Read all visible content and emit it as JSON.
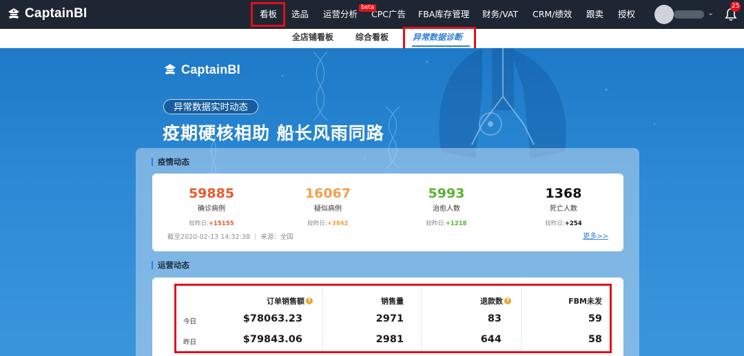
{
  "app": {
    "brand": "CaptainBI"
  },
  "nav": {
    "items": [
      "看板",
      "选品",
      "运营分析",
      "CPC广告",
      "FBA库存管理",
      "财务/VAT",
      "CRM/绩效",
      "跟卖",
      "授权"
    ],
    "beta_badge": "beta",
    "notification_count": "25"
  },
  "subnav": {
    "items": [
      "全店铺看板",
      "综合看板",
      "异常数据诊断"
    ]
  },
  "banner": {
    "brand": "CaptainBI",
    "pill": "异常数据实时动态",
    "headline": "疫期硬核相助 船长风雨同路"
  },
  "epidemic": {
    "title": "疫情动态",
    "stats": [
      {
        "value": "59885",
        "label": "确诊病例",
        "diff_prefix": "较昨日:",
        "diff": "+15155",
        "color": "#e8592c"
      },
      {
        "value": "16067",
        "label": "疑似病例",
        "diff_prefix": "较昨日:",
        "diff": "+3842",
        "color": "#f3a04a"
      },
      {
        "value": "5993",
        "label": "治愈人数",
        "diff_prefix": "较昨日:",
        "diff": "+1218",
        "color": "#58b42f"
      },
      {
        "value": "1368",
        "label": "死亡人数",
        "diff_prefix": "较昨日:",
        "diff": "+254",
        "color": "#111111"
      }
    ],
    "footnote": "截至2020-02-13 14:32:38 ｜ 来源：全国",
    "more_link": "更多>>"
  },
  "operations": {
    "title": "运营动态",
    "columns": [
      "订单销售额",
      "销售量",
      "退款数",
      "FBM未发"
    ],
    "rows": [
      {
        "label": "今日",
        "values": [
          "$78063.23",
          "2971",
          "83",
          "59"
        ]
      },
      {
        "label": "昨日",
        "values": [
          "$79843.06",
          "2981",
          "644",
          "58"
        ]
      }
    ]
  },
  "colors": {
    "accent": "#2f7fd9",
    "highlight": "#e0101a",
    "topbar": "#1f2633"
  }
}
